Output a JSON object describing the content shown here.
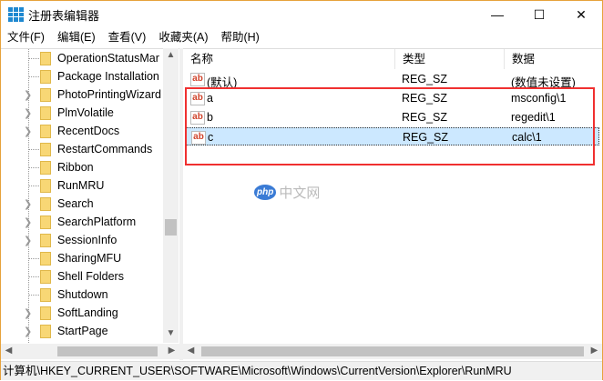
{
  "window": {
    "title": "注册表编辑器",
    "minimize": "—",
    "maximize": "☐",
    "close": "✕"
  },
  "menu": [
    "文件(F)",
    "编辑(E)",
    "查看(V)",
    "收藏夹(A)",
    "帮助(H)"
  ],
  "tree": [
    {
      "label": "OperationStatusMar",
      "expandable": false
    },
    {
      "label": "Package Installation",
      "expandable": false
    },
    {
      "label": "PhotoPrintingWizard",
      "expandable": true
    },
    {
      "label": "PlmVolatile",
      "expandable": true
    },
    {
      "label": "RecentDocs",
      "expandable": true
    },
    {
      "label": "RestartCommands",
      "expandable": false
    },
    {
      "label": "Ribbon",
      "expandable": false
    },
    {
      "label": "RunMRU",
      "expandable": false
    },
    {
      "label": "Search",
      "expandable": true
    },
    {
      "label": "SearchPlatform",
      "expandable": true
    },
    {
      "label": "SessionInfo",
      "expandable": true
    },
    {
      "label": "SharingMFU",
      "expandable": false
    },
    {
      "label": "Shell Folders",
      "expandable": false
    },
    {
      "label": "Shutdown",
      "expandable": false
    },
    {
      "label": "SoftLanding",
      "expandable": true
    },
    {
      "label": "StartPage",
      "expandable": true
    }
  ],
  "columns": {
    "name": "名称",
    "type": "类型",
    "data": "数据"
  },
  "values": [
    {
      "name": "(默认)",
      "type": "REG_SZ",
      "data": "(数值未设置)",
      "selected": false
    },
    {
      "name": "a",
      "type": "REG_SZ",
      "data": "msconfig\\1",
      "selected": false
    },
    {
      "name": "b",
      "type": "REG_SZ",
      "data": "regedit\\1",
      "selected": false
    },
    {
      "name": "c",
      "type": "REG_SZ",
      "data": "calc\\1",
      "selected": true
    }
  ],
  "icon_text": "ab",
  "watermark": {
    "logo": "php",
    "text": "中文网"
  },
  "status_path": "计算机\\HKEY_CURRENT_USER\\SOFTWARE\\Microsoft\\Windows\\CurrentVersion\\Explorer\\RunMRU"
}
